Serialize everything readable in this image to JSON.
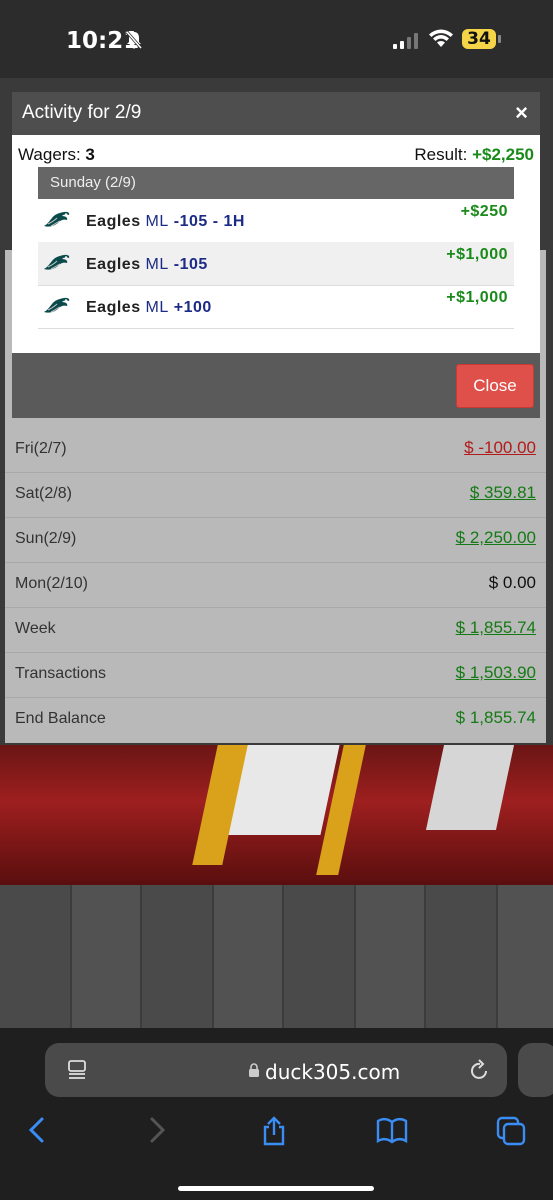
{
  "status_bar": {
    "time": "10:21",
    "battery": "34"
  },
  "modal": {
    "title": "Activity for 2/9",
    "close_x": "×",
    "wagers_label": "Wagers:",
    "wagers_count": "3",
    "result_label": "Result:",
    "result_value": "+$2,250",
    "day_header": "Sunday (2/9)",
    "bets": [
      {
        "team": "Eagles",
        "ml": "ML",
        "odds": "-105 - 1H",
        "amount": "+$250"
      },
      {
        "team": "Eagles",
        "ml": "ML",
        "odds": "-105",
        "amount": "+$1,000"
      },
      {
        "team": "Eagles",
        "ml": "ML",
        "odds": "+100",
        "amount": "+$1,000"
      }
    ],
    "close_button": "Close"
  },
  "table": {
    "rows": [
      {
        "label": "Fri(2/7)",
        "value": "$ -100.00"
      },
      {
        "label": "Sat(2/8)",
        "value": "$ 359.81"
      },
      {
        "label": "Sun(2/9)",
        "value": "$ 2,250.00"
      },
      {
        "label": "Mon(2/10)",
        "value": "$ 0.00"
      },
      {
        "label": "Week",
        "value": "$ 1,855.74"
      },
      {
        "label": "Transactions",
        "value": "$ 1,503.90"
      },
      {
        "label": "End Balance",
        "value": "$ 1,855.74"
      }
    ]
  },
  "browser": {
    "url": "duck305.com"
  },
  "colors": {
    "positive": "#157a15",
    "negative": "#b31b1b",
    "close_button": "#e0504a",
    "odds": "#1c2b85"
  },
  "icons": [
    "bell-slash-icon",
    "signal-icon",
    "wifi-icon",
    "battery-icon",
    "eagles-logo-icon",
    "lock-icon",
    "reader-icon",
    "reload-icon",
    "back-icon",
    "forward-icon",
    "share-icon",
    "bookmarks-icon",
    "tabs-icon"
  ]
}
